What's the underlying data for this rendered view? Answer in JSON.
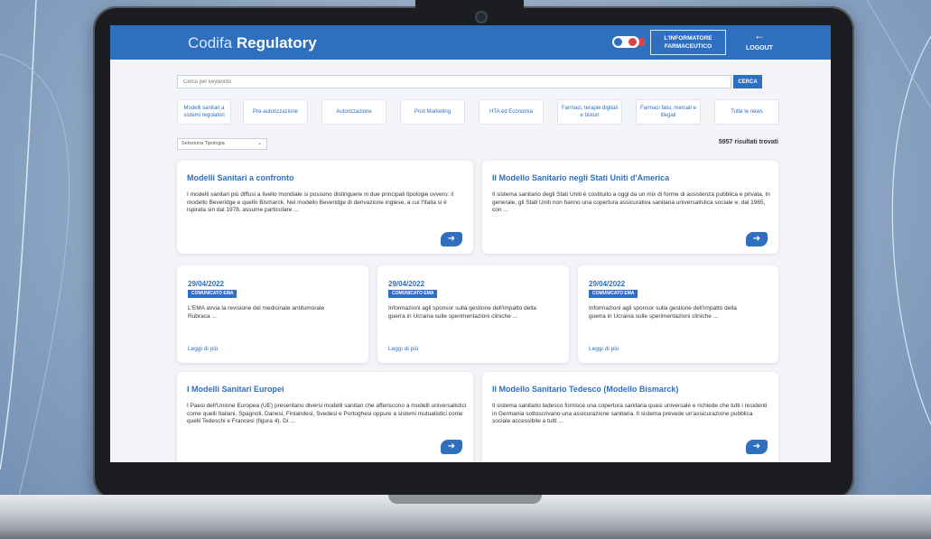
{
  "app": {
    "brand_light": "Codifa",
    "brand_bold": "Regulatory",
    "info_line1": "L'INFORMATORE",
    "info_line2": "FARMACEUTICO",
    "logout_label": "LOGOUT",
    "logout_icon": "arrow-left-icon"
  },
  "search": {
    "placeholder": "Cerca per keywords",
    "button_label": "CERCA"
  },
  "filters": [
    "Modelli sanitari a sistemi regolatori",
    "Pre-autorizzazione",
    "Autorizzazione",
    "Post Marketing",
    "HTA ed Economia",
    "Farmaci, terapie digitali e bisturi",
    "Farmaci falsi, mercati e illegali",
    "Tutte le news"
  ],
  "toolbar": {
    "select_value": "Seleziona Tipologia",
    "results_count": "5957 risultati trovati"
  },
  "articles": [
    {
      "title": "Modelli Sanitari a confronto",
      "body": "I modelli sanitari più diffusi a livello mondiale si possono distinguere in due principali tipologie ovvero: il modello Beveridge e quello Bismarck. Nel modello Beveridge di derivazione inglese, a cui l'Italia si è ispirata sin dal 1978, assume particolare ..."
    },
    {
      "title": "Il Modello Sanitario negli Stati Uniti d'America",
      "body": "Il sistema sanitario degli Stati Uniti è costituito a oggi da un mix di forme di assistenza pubblica e privata. In generale, gli Stati Uniti non hanno una copertura assicurativa sanitaria universalistica sociale e, dal 1965, con ..."
    },
    {
      "title": "I Modelli Sanitari Europei",
      "body": "I Paesi dell'Unione Europea (UE) presentano diversi modelli sanitari che afferiscono a modelli universalistici come quelli Italiani, Spagnoli, Danesi, Finlandesi, Svedesi e Portoghesi oppure a sistemi mutualistici come quelli Tedeschi e Francesi (figura 4). Di ..."
    },
    {
      "title": "Il Modello Sanitario Tedesco (Modello Bismarck)",
      "body": "Il sistema sanitario tedesco fornisce una copertura sanitaria quasi universale e richiede che tutti i residenti in Germania sottoscrivano una assicurazione sanitaria. Il sistema prevede un'assicurazione pubblica sociale accessibile a tutti ..."
    }
  ],
  "news": [
    {
      "date": "29/04/2022",
      "badge": "COMUNICATO EMA",
      "body": "L'EMA avvia la revisione del medicinale antitumorale Rubraca ...",
      "link": "Leggi di più"
    },
    {
      "date": "29/04/2022",
      "badge": "COMUNICATO EMA",
      "body": "Informazioni agli sponsor sulla gestione dell'impatto della guerra in Ucraina sulle sperimentazioni cliniche ...",
      "link": "Leggi di più"
    },
    {
      "date": "29/04/2022",
      "badge": "COMUNICATO EMA",
      "body": "Informazioni agli sponsor sulla gestione dell'impatto della guerra in Ucraina sulle sperimentazioni cliniche ...",
      "link": "Leggi di più"
    }
  ],
  "icons": {
    "card_arrow": "arrow-right-icon"
  },
  "colors": {
    "primary": "#2f6fc0",
    "accent_red": "#d9434b",
    "page_bg": "#f2f4f8"
  }
}
